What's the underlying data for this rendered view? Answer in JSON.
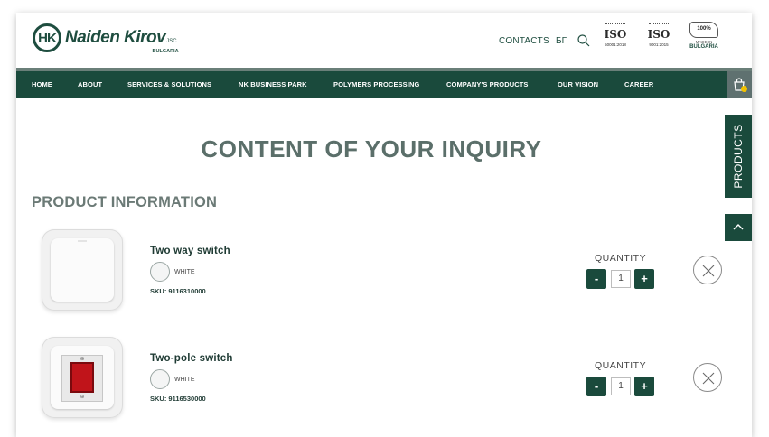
{
  "brand": {
    "mark": "HK",
    "name": "Naiden Kirov",
    "suffix": "JSC",
    "country": "BULGARIA"
  },
  "header": {
    "contacts": "CONTACTS",
    "lang": "БГ",
    "certs": [
      {
        "badge": "ISO",
        "sub": "50001:2018"
      },
      {
        "badge": "ISO",
        "sub": "9001:2015"
      }
    ],
    "made_in": {
      "top": "100%",
      "label": "MADE IN",
      "country": "BULGARIA"
    }
  },
  "nav": {
    "items": [
      "HOME",
      "ABOUT",
      "SERVICES & SOLUTIONS",
      "NK BUSINESS PARK",
      "POLYMERS PROCESSING",
      "COMPANY'S PRODUCTS",
      "OUR VISION",
      "CAREER"
    ]
  },
  "side": {
    "products_tab": "PRODUCTS"
  },
  "main": {
    "title": "CONTENT OF YOUR INQUIRY",
    "section": "PRODUCT INFORMATION",
    "quantity_label": "QUANTITY",
    "products": [
      {
        "name": "Two way switch",
        "color": "WHITE",
        "sku": "SKU: 9116310000",
        "quantity": "1",
        "minus": "-",
        "plus": "+"
      },
      {
        "name": "Two-pole switch",
        "color": "WHITE",
        "sku": "SKU: 9116530000",
        "quantity": "1",
        "minus": "-",
        "plus": "+"
      }
    ]
  },
  "colors": {
    "brand_green": "#1a4a3c",
    "title_gray": "#5b6f6a",
    "cart_dot": "#f2c200"
  }
}
